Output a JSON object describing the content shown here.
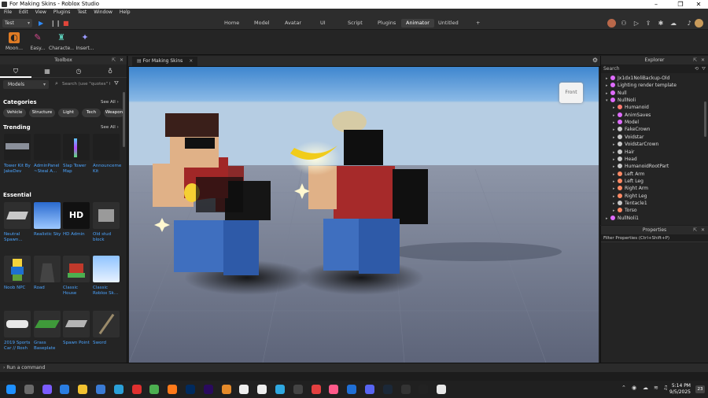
{
  "window": {
    "title": "For Making Skins - Roblox Studio",
    "minimize": "–",
    "maximize": "❐",
    "close": "✕"
  },
  "menu": [
    "File",
    "Edit",
    "View",
    "Plugins",
    "Test",
    "Window",
    "Help"
  ],
  "toolbar": {
    "mode": "Test",
    "tabs": [
      "Home",
      "Model",
      "Avatar",
      "UI",
      "Script",
      "Plugins",
      "Animator",
      "Untitled"
    ],
    "active_tab": "Animator",
    "add_tab": "+",
    "right_icons": [
      "avatar-icon",
      "collab-icon",
      "play-icon",
      "share-icon",
      "settings-icon",
      "cloud-icon",
      "bell-icon",
      "help-icon",
      "profile-icon"
    ]
  },
  "ribbon": [
    {
      "label": "Moon...",
      "icon": "moon-animator-icon",
      "color": "#e07b24"
    },
    {
      "label": "Easy...",
      "icon": "easy-pose-icon",
      "color": "#d24a8c"
    },
    {
      "label": "Characte...",
      "icon": "character-icon",
      "color": "#5ac8b4"
    },
    {
      "label": "Insert...",
      "icon": "insert-icon",
      "color": "#9a9aff"
    }
  ],
  "toolbox": {
    "title": "Toolbox",
    "tabs": [
      "bag-icon",
      "grid-icon",
      "clock-icon",
      "bulb-icon"
    ],
    "category_select": "Models",
    "search_placeholder": "Search (use \"quotes\" fo",
    "categories_title": "Categories",
    "see_all": "See All ›",
    "chips": [
      "Vehicle",
      "Structure",
      "Light",
      "Tech",
      "Weapon"
    ],
    "trending_title": "Trending",
    "trending": [
      {
        "name": "Tower Kit By JakeDev"
      },
      {
        "name": "AdminPanel ~Steal A..."
      },
      {
        "name": "Slap Tower Map"
      },
      {
        "name": "Announcement Kit"
      }
    ],
    "essential_title": "Essential",
    "essential": [
      {
        "name": "Neutral Spawn..."
      },
      {
        "name": "Realistic Sky"
      },
      {
        "name": "HD Admin",
        "badge": "HD"
      },
      {
        "name": "Old stud block"
      },
      {
        "name": "Noob NPC"
      },
      {
        "name": "Road"
      },
      {
        "name": "Classic House"
      },
      {
        "name": "Classic Roblox Sk..."
      },
      {
        "name": "2019 Sports Car // Rosh"
      },
      {
        "name": "Grass Baseplate"
      },
      {
        "name": "Spawn Point"
      },
      {
        "name": "Sword"
      }
    ]
  },
  "viewport": {
    "tab": "For Making Skins",
    "tab_close": "×",
    "view_cube": "Front"
  },
  "explorer": {
    "title": "Explorer",
    "search_placeholder": "Search",
    "items": [
      {
        "label": "Jx1dx1NoliBackup-Old",
        "level": 0,
        "expanded": false,
        "icon_color": "#e06cff"
      },
      {
        "label": "Lighting render template",
        "level": 0,
        "expanded": false,
        "icon_color": "#e06cff"
      },
      {
        "label": "Null",
        "level": 0,
        "expanded": false,
        "icon_color": "#e06cff"
      },
      {
        "label": "NullNoli",
        "level": 0,
        "expanded": true,
        "icon_color": "#e06cff"
      },
      {
        "label": "Humanoid",
        "level": 1,
        "expanded": false,
        "icon_color": "#ff7b72"
      },
      {
        "label": "AnimSaves",
        "level": 1,
        "expanded": false,
        "icon_color": "#e06cff"
      },
      {
        "label": "Model",
        "level": 1,
        "expanded": false,
        "icon_color": "#e06cff"
      },
      {
        "label": "FakeCrown",
        "level": 1,
        "expanded": false,
        "icon_color": "#c8c8c8"
      },
      {
        "label": "Voidstar",
        "level": 1,
        "expanded": false,
        "icon_color": "#c8c8c8"
      },
      {
        "label": "VoidstarCrown",
        "level": 1,
        "expanded": false,
        "icon_color": "#c8c8c8"
      },
      {
        "label": "Hair",
        "level": 1,
        "expanded": false,
        "icon_color": "#c8c8c8"
      },
      {
        "label": "Head",
        "level": 1,
        "expanded": false,
        "icon_color": "#c8c8c8"
      },
      {
        "label": "HumanoidRootPart",
        "level": 1,
        "expanded": false,
        "icon_color": "#c8c8c8"
      },
      {
        "label": "Left Arm",
        "level": 1,
        "expanded": false,
        "icon_color": "#ff8a65"
      },
      {
        "label": "Left Leg",
        "level": 1,
        "expanded": false,
        "icon_color": "#ff8a65"
      },
      {
        "label": "Right Arm",
        "level": 1,
        "expanded": false,
        "icon_color": "#ff8a65"
      },
      {
        "label": "Right Leg",
        "level": 1,
        "expanded": false,
        "icon_color": "#ff8a65"
      },
      {
        "label": "Tentacle1",
        "level": 1,
        "expanded": false,
        "icon_color": "#c8c8c8"
      },
      {
        "label": "Torso",
        "level": 1,
        "expanded": false,
        "icon_color": "#ff8a65"
      },
      {
        "label": "NullNoli1",
        "level": 0,
        "expanded": false,
        "icon_color": "#e06cff"
      }
    ]
  },
  "properties": {
    "title": "Properties",
    "filter_placeholder": "Filter Properties (Ctrl+Shift+P)"
  },
  "command_bar": {
    "placeholder": "Run a command"
  },
  "taskbar": {
    "time": "5:14 PM",
    "date": "9/5/2025",
    "notification_count": "23",
    "apps": [
      "windows-icon",
      "taskview-icon",
      "copilot-icon",
      "mail-icon",
      "explorer-icon",
      "store-icon",
      "edge-icon",
      "opera-icon",
      "chrome-icon",
      "firefox-icon",
      "animate-icon",
      "premiere-icon",
      "blender-icon",
      "file-icon",
      "file-icon",
      "photoshop-icon",
      "roblox-studio-icon",
      "anydesk-icon",
      "media-icon",
      "vscode-icon",
      "discord-icon",
      "steam-icon",
      "obs-icon",
      "capcut-icon",
      "roblox-icon"
    ]
  }
}
